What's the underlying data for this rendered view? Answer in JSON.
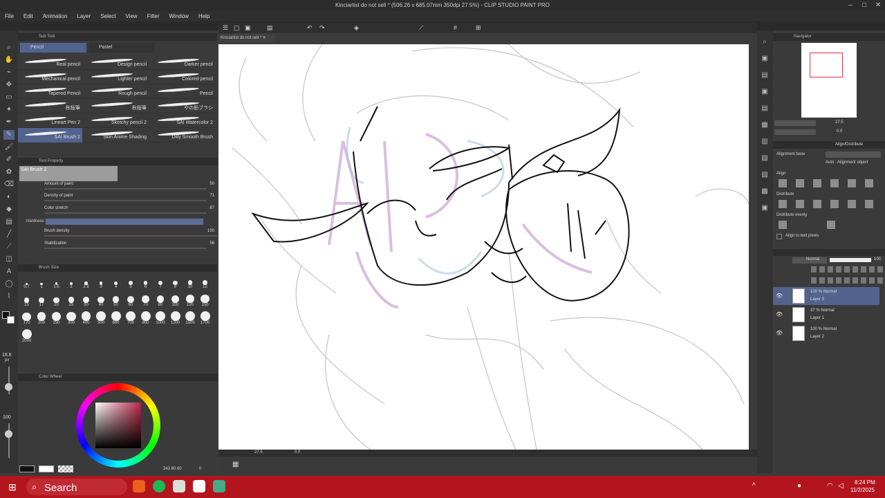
{
  "window": {
    "title": "Kinciartist do not sell * (506.26 x 685.07mm 350dpi 27.5%) - CLIP STUDIO PAINT PRO"
  },
  "menu": [
    "File",
    "Edit",
    "Animation",
    "Layer",
    "Select",
    "View",
    "Filter",
    "Window",
    "Help"
  ],
  "canvas_tab": "Kinciartist do not sell *",
  "subtool": {
    "title": "Sub Tool",
    "tabs": [
      "Pencil",
      "Pastel"
    ],
    "brushes": [
      [
        "Real pencil",
        "Design pencil",
        "Darker pencil"
      ],
      [
        "Mechanical pencil",
        "Lighter pencil",
        "Colored pencil"
      ],
      [
        "Tapered Pencil",
        "Rough pencil",
        "Pencil"
      ],
      [
        "秋桜筆",
        "秋桜筆",
        "やの鉛ブラシ"
      ],
      [
        "Lineart Pen 2",
        "Sketchy pencil 2",
        "SAI Watercolor 2"
      ],
      [
        "SAI Brush 2",
        "Skin Anime Shading",
        "Dilly Smooth Brush"
      ]
    ]
  },
  "tool_property": {
    "title": "Tool Property",
    "brush_name": "SAI Brush 2",
    "partial": "Amount of paint",
    "partial_value": "50",
    "rows": [
      {
        "label": "Density of paint",
        "value": "71"
      },
      {
        "label": "Color stretch",
        "value": "87"
      },
      {
        "label": "Hardness",
        "value": ""
      },
      {
        "label": "Brush density",
        "value": "100"
      },
      {
        "label": "Stabilization",
        "value": "56"
      }
    ]
  },
  "brush_size": {
    "title": "Brush Size",
    "sizes": [
      "0.7",
      "1",
      "1.5",
      "2",
      "2.5",
      "3",
      "4",
      "5",
      "6",
      "7",
      "8",
      "10",
      "12",
      "15",
      "17",
      "20",
      "25",
      "30",
      "40",
      "50",
      "60",
      "70",
      "80",
      "100",
      "120",
      "150",
      "170",
      "200",
      "250",
      "300",
      "400",
      "500",
      "600",
      "700",
      "800",
      "1000",
      "1200",
      "1500",
      "1700",
      "2000"
    ]
  },
  "left_readouts": {
    "size": "18.6",
    "size_unit": "px",
    "opacity": "100"
  },
  "color_wheel": {
    "title": "Color Wheel",
    "readout": "343 80 80",
    "readout_end": "0"
  },
  "status": {
    "zoom": "27.5",
    "angle": "0.0"
  },
  "navigator": {
    "title": "Navigator",
    "zoom": "27.5",
    "angle": "0.0"
  },
  "align": {
    "title": "Align/Distribute",
    "alignment_base": "Alignment base",
    "auto": "Auto : Alignment object",
    "align": "Align",
    "distribute": "Distribute",
    "distribute_evenly": "Distribute evenly",
    "pixels": "Align to text pixels"
  },
  "layers": {
    "blend": "Normal",
    "opacity": "100",
    "items": [
      {
        "mode": "100 % Normal",
        "name": "Layer 3"
      },
      {
        "mode": "37 % Normal",
        "name": "Layer 1"
      },
      {
        "mode": "100 % Normal",
        "name": "Layer 2"
      }
    ]
  },
  "taskbar": {
    "search": "Search",
    "time": "8:24 PM",
    "date": "11/2/2025"
  },
  "colors": {
    "accent": "#52638d",
    "taskbar": "#b3151e",
    "swatch": "#b8284a"
  }
}
